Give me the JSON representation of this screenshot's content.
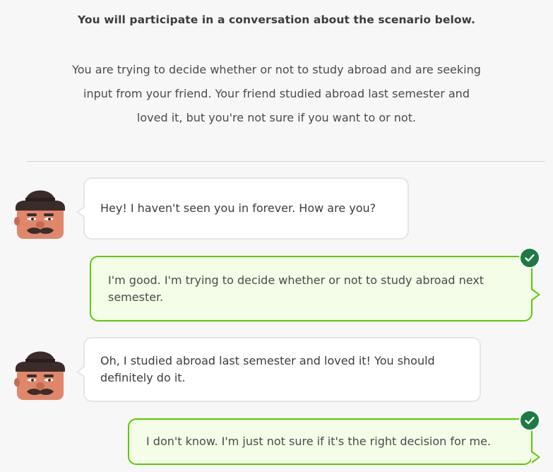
{
  "header": {
    "instruction": "You will participate in a conversation about the scenario below.",
    "scenario_lines": [
      "You are trying to decide whether or not to study abroad and are seeking",
      "input from your friend. Your friend studied abroad last semester and",
      "loved it, but you're not sure if you want to or not."
    ]
  },
  "conversation": [
    {
      "speaker": "friend",
      "avatar_icon": "character-avatar-icon",
      "text": "Hey! I haven't seen you in forever. How are you?"
    },
    {
      "speaker": "user",
      "status_icon": "checkmark-icon",
      "text": "I'm good. I'm trying to decide whether or not to study abroad next semester."
    },
    {
      "speaker": "friend",
      "avatar_icon": "character-avatar-icon",
      "text": "Oh, I studied abroad last semester and loved it! You should definitely do it."
    },
    {
      "speaker": "user",
      "status_icon": "checkmark-icon",
      "text": "I don't know. I'm just not sure if it's the right decision for me."
    }
  ],
  "colors": {
    "background": "#f7f7f7",
    "user_bubble_border": "#58cc02",
    "user_bubble_fill": "#f4fde8",
    "check_badge": "#1d7a45",
    "friend_bubble_border": "#e5e5e5"
  }
}
